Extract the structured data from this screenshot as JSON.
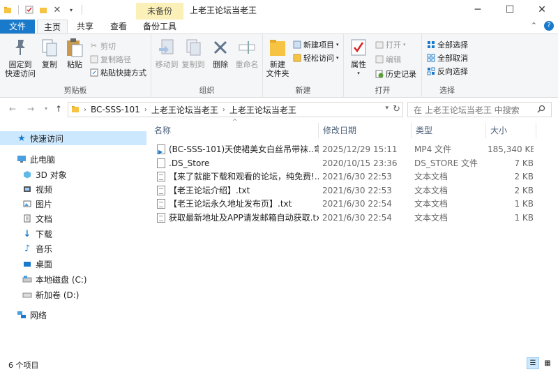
{
  "window": {
    "title": "上老王论坛当老王",
    "context_tab": "未备份"
  },
  "ribbon_tabs": {
    "file": "文件",
    "home": "主页",
    "share": "共享",
    "view": "查看",
    "backup": "备份工具"
  },
  "ribbon": {
    "clipboard": {
      "group": "剪贴板",
      "pin": "固定到\n快速访问",
      "copy": "复制",
      "paste": "粘贴",
      "cut": "剪切",
      "copy_path": "复制路径",
      "paste_shortcut": "粘贴快捷方式"
    },
    "organize": {
      "group": "组织",
      "move_to": "移动到",
      "copy_to": "复制到",
      "delete": "删除",
      "rename": "重命名"
    },
    "new": {
      "group": "新建",
      "new_folder": "新建\n文件夹",
      "new_item": "新建项目",
      "easy_access": "轻松访问"
    },
    "open": {
      "group": "打开",
      "properties": "属性",
      "open": "打开",
      "edit": "编辑",
      "history": "历史记录"
    },
    "select": {
      "group": "选择",
      "select_all": "全部选择",
      "select_none": "全部取消",
      "invert": "反向选择"
    }
  },
  "address": {
    "crumbs": [
      "BC-SSS-101",
      "上老王论坛当老王",
      "上老王论坛当老王"
    ],
    "search_placeholder": "在 上老王论坛当老王 中搜索"
  },
  "nav": {
    "quick_access": "快速访问",
    "this_pc": "此电脑",
    "objects_3d": "3D 对象",
    "videos": "视频",
    "pictures": "图片",
    "documents": "文档",
    "downloads": "下载",
    "music": "音乐",
    "desktop": "桌面",
    "local_disk": "本地磁盘 (C:)",
    "new_volume": "新加卷 (D:)",
    "network": "网络"
  },
  "columns": {
    "name": "名称",
    "date": "修改日期",
    "type": "类型",
    "size": "大小"
  },
  "files": [
    {
      "name": "(BC-SSS-101)天使裙美女白丝吊带袜..弯...",
      "date": "2025/12/29 15:11",
      "type": "MP4 文件",
      "size": "185,340 KB",
      "icon": "mp4"
    },
    {
      "name": ".DS_Store",
      "date": "2020/10/15 23:36",
      "type": "DS_STORE 文件",
      "size": "7 KB",
      "icon": "blank"
    },
    {
      "name": "【来了就能下载和观看的论坛，纯免费!...",
      "date": "2021/6/30 22:53",
      "type": "文本文档",
      "size": "2 KB",
      "icon": "txt"
    },
    {
      "name": "【老王论坛介绍】.txt",
      "date": "2021/6/30 22:53",
      "type": "文本文档",
      "size": "2 KB",
      "icon": "txt"
    },
    {
      "name": "【老王论坛永久地址发布页】.txt",
      "date": "2021/6/30 22:54",
      "type": "文本文档",
      "size": "1 KB",
      "icon": "txt"
    },
    {
      "name": "获取最新地址及APP请发邮箱自动获取.txt",
      "date": "2021/6/30 22:54",
      "type": "文本文档",
      "size": "1 KB",
      "icon": "txt"
    }
  ],
  "status": {
    "item_count": "6 个项目"
  }
}
